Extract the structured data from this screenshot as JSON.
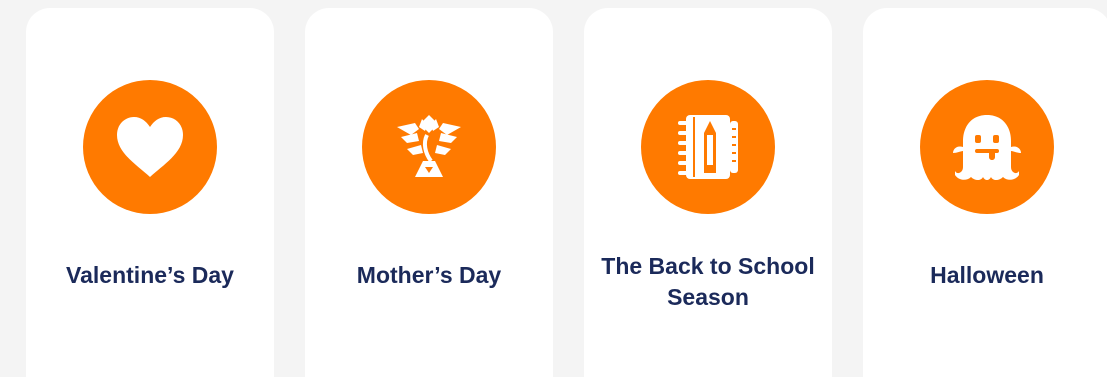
{
  "colors": {
    "accent": "#ff7a00",
    "title": "#1b2a5a",
    "card": "#ffffff",
    "background": "#f4f4f4"
  },
  "cards": [
    {
      "title": "Valentine’s Day",
      "icon": "heart-icon"
    },
    {
      "title": "Mother’s Day",
      "icon": "flower-bouquet-icon"
    },
    {
      "title": "The Back to School Season",
      "icon": "notebook-pencil-icon"
    },
    {
      "title": "Halloween",
      "icon": "ghost-icon"
    }
  ]
}
